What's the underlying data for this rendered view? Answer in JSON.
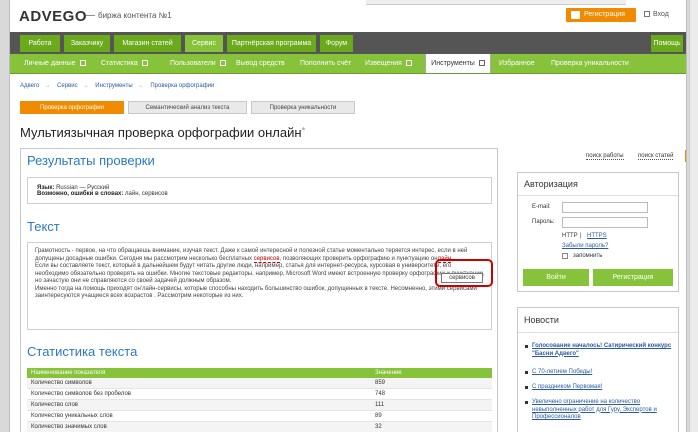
{
  "header": {
    "logo": "ADVEGO",
    "dash": "—",
    "tagline": "биржа контента №1",
    "register_label": "Регистрация",
    "login_label": "Вход"
  },
  "nav_main": [
    "Работа",
    "Заказчику",
    "Магазин статей",
    "Сервис",
    "Партнёрская программа",
    "Форум",
    "Помощь"
  ],
  "nav_sub": [
    "Личные данные",
    "Статистика",
    "Пользователи",
    "Вывод средств",
    "Пополнить счёт",
    "Извещения",
    "Инструменты",
    "Избранное",
    "Проверка уникальности"
  ],
  "breadcrumbs": [
    "Адвего",
    "Сервис",
    "Инструменты",
    "Проверка орфографии"
  ],
  "subtabs": [
    "Проверка орфографии",
    "Семантический анализ текста",
    "Проверка уникальности"
  ],
  "page_title": "Мультиязычная проверка орфографии онлайн",
  "results": {
    "title": "Результаты проверки",
    "lang_label": "Язык:",
    "lang_value": "Russian — Русский",
    "errors_label": "Возможно, ошибки в словах:",
    "errors_value": "лайн, сервисов"
  },
  "text_section": {
    "title": "Текст",
    "p1a": "Грамотность - первое, на что обращаешь внимание, изучая текст. Даже к самой интересной и полезной статье моментально теряется интерес, если в ней допущены досадные ошибки. Сегодня мы рассмотрим несколько бесплатных ",
    "p1err": "сервисов",
    "p1b": ", позволяющих проверить орфографию и пунктуацию он",
    "p1err2": "лайн",
    "p1c": ".",
    "p2": "Если вы составляете текст, который в дальнейшем будут читать другие люди, например, статья для интернет-ресурса, курсовая в университете, его необходимо обязательно проверять на ошибки. Многие текстовые редакторы, например, Microsoft Word имеют встроенную проверку орфографии и пунктуации, но зачастую они не справляются со своей задачей должным образом.",
    "p3": "Именно тогда на помощь приходят он'лайн-сервисы, которые способны находить большинство ошибок, допущенных в тексте. Несомненно, этими сервисами заинтересуются учащиеся всех возрастов . Рассмотрим некоторые из них.",
    "suggestion": "сервисов"
  },
  "stats": {
    "title": "Статистика текста",
    "col1": "Наименование показателя",
    "col2": "Значение",
    "rows": [
      {
        "name": "Количество символов",
        "value": "859"
      },
      {
        "name": "Количество символов без пробелов",
        "value": "748"
      },
      {
        "name": "Количество слов",
        "value": "111"
      },
      {
        "name": "Количество уникальных слов",
        "value": "89"
      },
      {
        "name": "Количество значимых слов",
        "value": "32"
      }
    ]
  },
  "sidebar": {
    "search_work": "поиск работы",
    "search_articles": "поиск статей",
    "auth_title": "Авторизация",
    "email_label": "E-mail:",
    "password_label": "Пароль:",
    "http": "HTTP",
    "sep": "|",
    "https": "HTTPS",
    "forgot": "Забыли пароль?",
    "remember": "запомнить",
    "login_btn": "Войти",
    "register_btn": "Регистрация",
    "news_title": "Новости",
    "news": [
      "Голосование началось! Сатирический конкурс \"Басни Адвего\"",
      "С 70-летием Победы!",
      "С праздником Первомая!",
      "Увеличено ограничение на количество невыполненных работ для Гуру, Экспертов и Профессионалов"
    ]
  }
}
